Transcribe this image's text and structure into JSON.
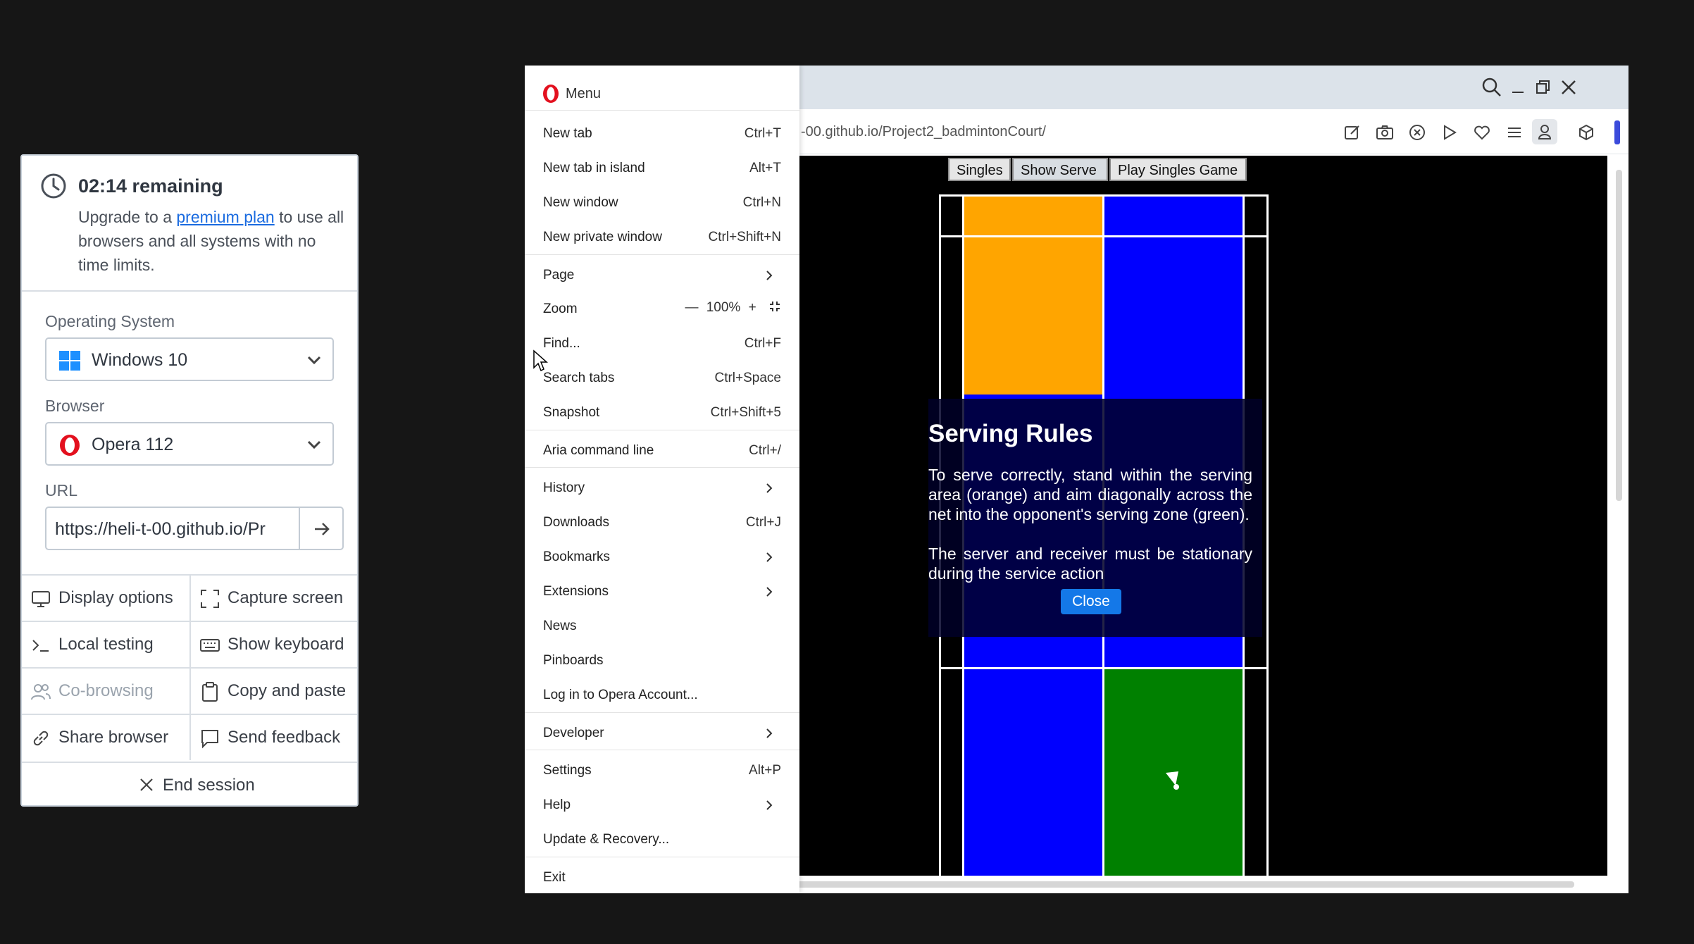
{
  "panel": {
    "timer": {
      "remaining": "02:14 remaining",
      "desc_pre": "Upgrade to a ",
      "link": "premium plan",
      "desc_post": " to use all browsers and all systems with no time limits."
    },
    "os": {
      "label": "Operating System",
      "value": "Windows 10"
    },
    "browser": {
      "label": "Browser",
      "value": "Opera 112"
    },
    "url": {
      "label": "URL",
      "value": "https://heli-t-00.github.io/Pr"
    },
    "actions": {
      "display_options": "Display options",
      "capture_screen": "Capture screen",
      "local_testing": "Local testing",
      "show_keyboard": "Show keyboard",
      "co_browsing": "Co-browsing",
      "copy_paste": "Copy and paste",
      "share_browser": "Share browser",
      "send_feedback": "Send feedback",
      "end_session": "End session"
    }
  },
  "browser": {
    "address": "-00.github.io/Project2_badmintonCourt/"
  },
  "page": {
    "buttons": {
      "singles": "Singles",
      "show_serve": "Show Serve",
      "play": "Play Singles Game"
    },
    "colors": {
      "orange": "#ffa500",
      "blue": "#0000ff",
      "green": "#008000"
    },
    "modal": {
      "title": "Serving Rules",
      "p1": "To serve correctly, stand within the serving area (orange) and aim diagonally across the net into the opponent's serving zone (green).",
      "p2": "The server and receiver must be stationary during the service action",
      "close": "Close"
    }
  },
  "menu": {
    "title": "Menu",
    "items": {
      "new_tab": {
        "label": "New tab",
        "shortcut": "Ctrl+T"
      },
      "new_tab_island": {
        "label": "New tab in island",
        "shortcut": "Alt+T"
      },
      "new_window": {
        "label": "New window",
        "shortcut": "Ctrl+N"
      },
      "new_private": {
        "label": "New private window",
        "shortcut": "Ctrl+Shift+N"
      },
      "page": {
        "label": "Page"
      },
      "zoom": {
        "label": "Zoom",
        "minus": "—",
        "value": "100%",
        "plus": "+"
      },
      "find": {
        "label": "Find...",
        "shortcut": "Ctrl+F"
      },
      "search_tabs": {
        "label": "Search tabs",
        "shortcut": "Ctrl+Space"
      },
      "snapshot": {
        "label": "Snapshot",
        "shortcut": "Ctrl+Shift+5"
      },
      "aria": {
        "label": "Aria command line",
        "shortcut": "Ctrl+/"
      },
      "history": {
        "label": "History"
      },
      "downloads": {
        "label": "Downloads",
        "shortcut": "Ctrl+J"
      },
      "bookmarks": {
        "label": "Bookmarks"
      },
      "extensions": {
        "label": "Extensions"
      },
      "news": {
        "label": "News"
      },
      "pinboards": {
        "label": "Pinboards"
      },
      "login": {
        "label": "Log in to Opera Account..."
      },
      "developer": {
        "label": "Developer"
      },
      "settings": {
        "label": "Settings",
        "shortcut": "Alt+P"
      },
      "help": {
        "label": "Help"
      },
      "update": {
        "label": "Update & Recovery..."
      },
      "exit": {
        "label": "Exit"
      }
    }
  },
  "icons": [
    "clock-icon",
    "windows-icon",
    "opera-icon",
    "chevron-down-icon",
    "arrow-right-icon",
    "monitor-icon",
    "capture-icon",
    "terminal-icon",
    "keyboard-icon",
    "users-icon",
    "clipboard-icon",
    "link-icon",
    "message-icon",
    "close-icon",
    "search-icon",
    "minimize-icon",
    "restore-icon",
    "edit-icon",
    "camera-icon",
    "shield-icon",
    "play-icon",
    "heart-icon",
    "menu-lines-icon",
    "profile-icon",
    "cube-icon",
    "chevron-right-icon",
    "fullscreen-icon"
  ]
}
